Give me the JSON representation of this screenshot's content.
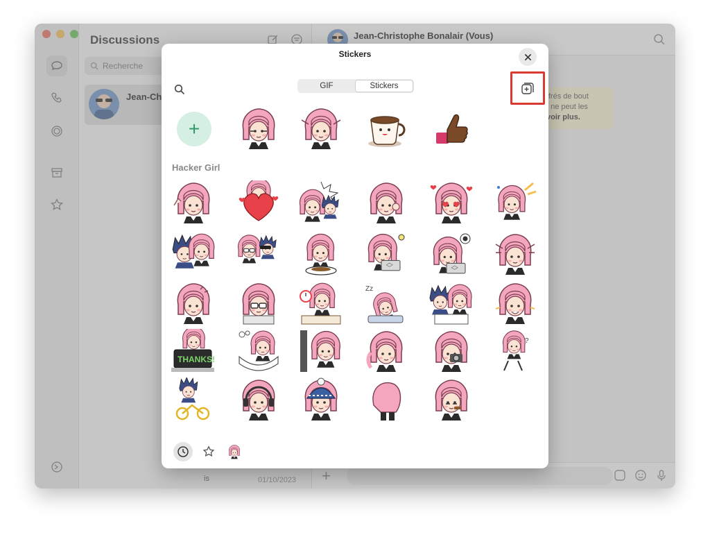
{
  "background": {
    "chatlist": {
      "title": "Discussions",
      "search_placeholder": "Recherche",
      "chat": {
        "name": "Jean-Ch",
        "snippet": "is",
        "date": "01/10/2023"
      }
    },
    "conversation": {
      "contact_name": "Jean-Christophe Bonalair (Vous)",
      "notice_line1": "ffrés de bout",
      "notice_line2": ", ne peut les",
      "notice_line3": "voir plus."
    }
  },
  "modal": {
    "title": "Stickers",
    "tabs": [
      {
        "label": "GIF",
        "selected": false
      },
      {
        "label": "Stickers",
        "selected": true
      }
    ],
    "section_title": "Hacker Girl",
    "colors": {
      "highlight": "#d93a2f",
      "accent": "#2e9b6a",
      "hair": "#f3a6bd"
    }
  }
}
